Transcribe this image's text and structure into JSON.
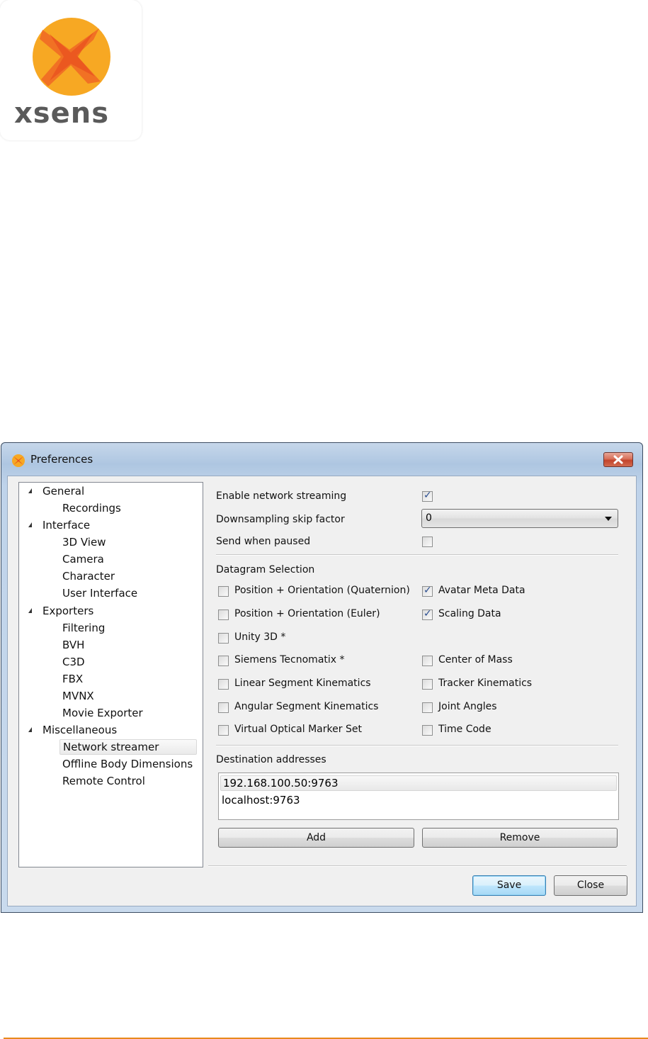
{
  "logo": {
    "wordmark": "xsens",
    "brand_color": "#f7a823",
    "accent_color": "#ea5b1c"
  },
  "window": {
    "title": "Preferences",
    "close_icon": "close-icon"
  },
  "tree": {
    "groups": [
      {
        "label": "General",
        "children": [
          "Recordings"
        ]
      },
      {
        "label": "Interface",
        "children": [
          "3D View",
          "Camera",
          "Character",
          "User Interface"
        ]
      },
      {
        "label": "Exporters",
        "children": [
          "Filtering",
          "BVH",
          "C3D",
          "FBX",
          "MVNX",
          "Movie Exporter"
        ]
      },
      {
        "label": "Miscellaneous",
        "children": [
          "Network streamer",
          "Offline Body Dimensions",
          "Remote Control"
        ]
      }
    ],
    "selected": "Network streamer"
  },
  "settings": {
    "enable_streaming": {
      "label": "Enable network streaming",
      "checked": true
    },
    "downsampling": {
      "label": "Downsampling skip factor",
      "value": "0"
    },
    "send_when_paused": {
      "label": "Send when paused",
      "checked": false
    }
  },
  "datagram": {
    "heading": "Datagram Selection",
    "left": [
      {
        "label": "Position + Orientation (Quaternion)",
        "checked": false
      },
      {
        "label": "Position + Orientation (Euler)",
        "checked": false
      },
      {
        "label": "Unity 3D *",
        "checked": false
      },
      {
        "label": "Siemens Tecnomatix *",
        "checked": false
      },
      {
        "label": "Linear Segment Kinematics",
        "checked": false
      },
      {
        "label": "Angular Segment Kinematics",
        "checked": false
      },
      {
        "label": "Virtual Optical Marker Set",
        "checked": false
      }
    ],
    "right": [
      {
        "label": "Avatar Meta Data",
        "checked": true
      },
      {
        "label": "Scaling Data",
        "checked": true
      },
      {
        "label": "",
        "checked": null
      },
      {
        "label": "Center of Mass",
        "checked": false
      },
      {
        "label": "Tracker Kinematics",
        "checked": false
      },
      {
        "label": "Joint Angles",
        "checked": false
      },
      {
        "label": "Time Code",
        "checked": false
      }
    ]
  },
  "destinations": {
    "heading": "Destination addresses",
    "items": [
      "192.168.100.50:9763",
      "localhost:9763"
    ],
    "selected_index": 0,
    "add_label": "Add",
    "remove_label": "Remove"
  },
  "footer": {
    "save_label": "Save",
    "close_label": "Close"
  },
  "check_glyph": "✓"
}
